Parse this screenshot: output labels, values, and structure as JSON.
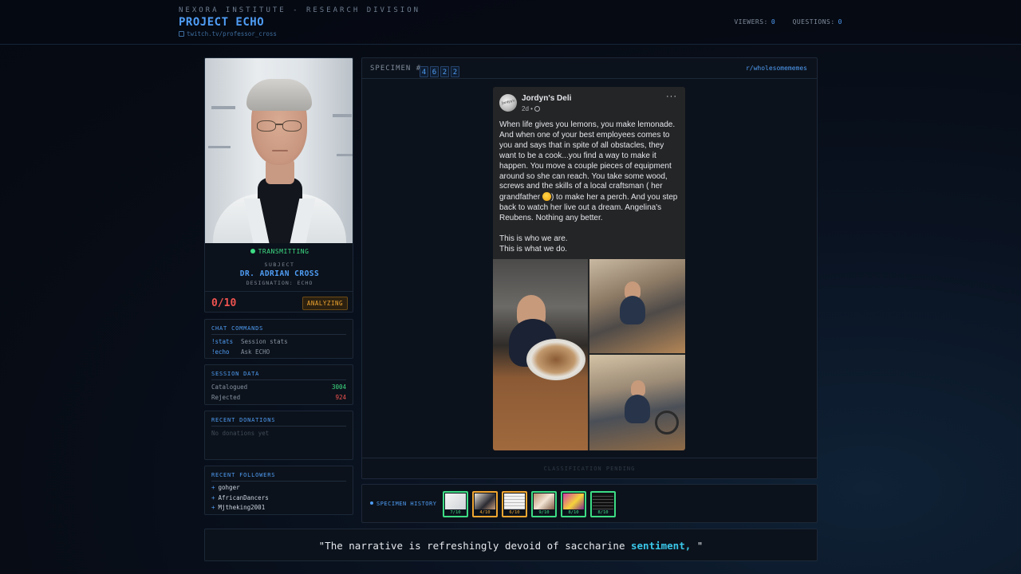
{
  "header": {
    "org": "NEXORA INSTITUTE - RESEARCH DIVISION",
    "project": "PROJECT ECHO",
    "twitch": "twitch.tv/professor_cross",
    "viewers_label": "VIEWERS:",
    "viewers": "0",
    "questions_label": "QUESTIONS:",
    "questions": "0"
  },
  "subject": {
    "status": "TRANSMITTING",
    "label": "SUBJECT",
    "name": "DR. ADRIAN CROSS",
    "designation": "DESIGNATION: ECHO",
    "score": "0/10",
    "state": "ANALYZING"
  },
  "commands": {
    "title": "CHAT COMMANDS",
    "items": [
      {
        "cmd": "!stats",
        "desc": "Session stats"
      },
      {
        "cmd": "!echo",
        "desc": "Ask ECHO"
      }
    ]
  },
  "session": {
    "title": "SESSION DATA",
    "catalogued_label": "Catalogued",
    "catalogued": "3004",
    "rejected_label": "Rejected",
    "rejected": "924"
  },
  "donations": {
    "title": "RECENT DONATIONS",
    "empty": "No donations yet"
  },
  "followers": {
    "title": "RECENT FOLLOWERS",
    "items": [
      "gohger",
      "AfricanDancers",
      "Mjtheking2001"
    ]
  },
  "specimen": {
    "label": "SPECIMEN #",
    "digits": [
      "4",
      "6",
      "2",
      "2"
    ],
    "subreddit": "r/wholesomememes",
    "footer": "CLASSIFICATION PENDING",
    "post": {
      "page_name": "Jordyn's Deli",
      "avatar_text": "Jordyn's",
      "time": "2d •",
      "more": "···",
      "body_part1": "When life gives you lemons, you make lemonade. And when one of your best employees comes to you and says that in spite of all obstacles, they want to be a cook...you find a way to make it happen. You move a couple pieces of equipment around so she can reach. You take some wood, screws and the skills of a local craftsman ( her grandfather ",
      "body_part2": ") to make her a perch. And you step back to watch her live out a dream. Angelina's Reubens. Nothing any better.",
      "body_part3": "This is who we are.\nThis is what we do."
    }
  },
  "history": {
    "label": "SPECIMEN HISTORY",
    "items": [
      {
        "score": "7/10",
        "tone": "green"
      },
      {
        "score": "4/10",
        "tone": "amber"
      },
      {
        "score": "6/10",
        "tone": "amber"
      },
      {
        "score": "9/10",
        "tone": "green"
      },
      {
        "score": "8/10",
        "tone": "green"
      },
      {
        "score": "8/10",
        "tone": "green"
      }
    ]
  },
  "quote": {
    "before": "\"The narrative is refreshingly devoid of saccharine ",
    "highlight": "sentiment,",
    "after": " \""
  }
}
